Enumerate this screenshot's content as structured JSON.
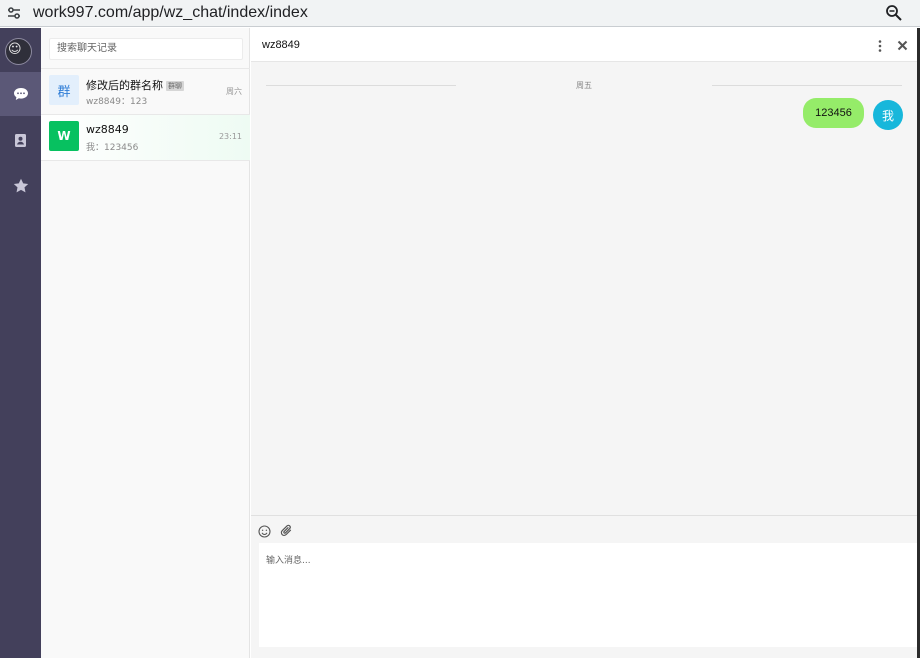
{
  "browser": {
    "url": "work997.com/app/wz_chat/index/index",
    "left_icon": "tune-icon",
    "right_icon": "zoom-icon"
  },
  "nav": {
    "avatar_icon": "user-avatar",
    "items": [
      {
        "icon": "chat-bubble-icon",
        "active": true
      },
      {
        "icon": "contacts-book-icon",
        "active": false
      },
      {
        "icon": "star-icon",
        "active": false
      }
    ],
    "colors": {
      "background": "#43405b",
      "active": "#5b5877"
    }
  },
  "search": {
    "placeholder": "搜索聊天记录"
  },
  "conversations": [
    {
      "avatar_text": "群",
      "name": "修改后的群名称",
      "tag": "群聊",
      "preview": "wz8849：123",
      "time": "周六"
    },
    {
      "avatar_text": "W",
      "name": "wz8849",
      "preview": "我：123456",
      "time": "23:11",
      "selected": true
    }
  ],
  "chat": {
    "title": "wz8849",
    "date_separator": "周五",
    "messages": [
      {
        "from": "me",
        "avatar_text": "我",
        "text": "123456"
      }
    ],
    "toolbar_icons": [
      "emoji-icon",
      "paperclip-icon"
    ],
    "input_placeholder": "输入消息...",
    "colors": {
      "bubble": "#95ec69",
      "me_avatar": "#17b7db"
    }
  }
}
